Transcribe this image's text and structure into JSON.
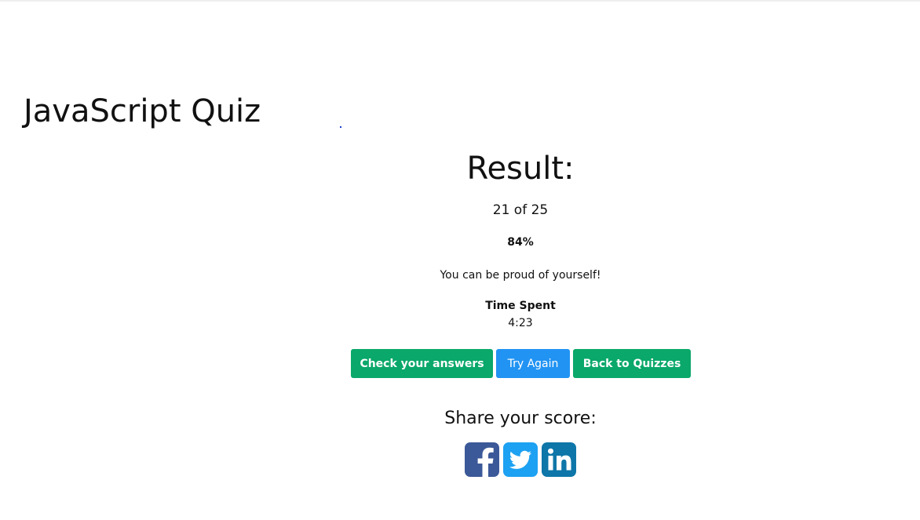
{
  "page": {
    "title": "JavaScript Quiz"
  },
  "result": {
    "heading": "Result:",
    "score": "21 of 25",
    "percent": "84%",
    "message": "You can be proud of yourself!",
    "time_label": "Time Spent",
    "time_value": "4:23"
  },
  "actions": {
    "check_answers": "Check your answers",
    "try_again": "Try Again",
    "back_to_quizzes": "Back to Quizzes"
  },
  "share": {
    "heading": "Share your score:",
    "icons": [
      "facebook-icon",
      "twitter-icon",
      "linkedin-icon"
    ]
  },
  "colors": {
    "green": "#0aa86a",
    "blue": "#2193f3",
    "facebook": "#3b5998",
    "twitter": "#1da1f2",
    "linkedin": "#0e76a8"
  }
}
